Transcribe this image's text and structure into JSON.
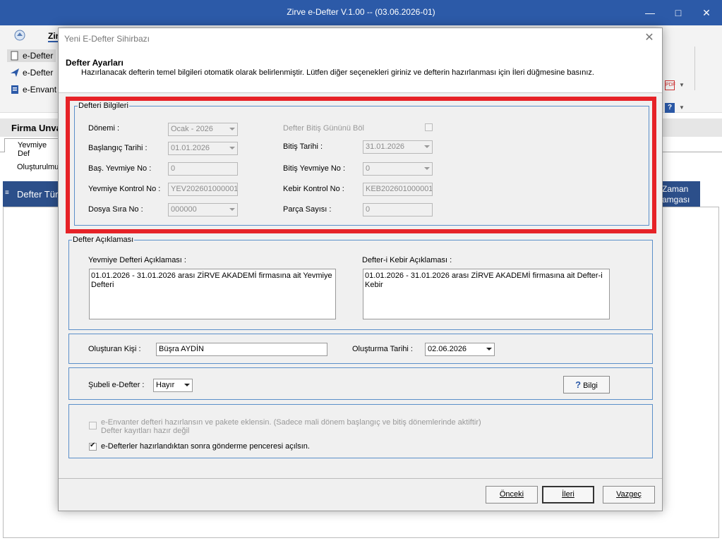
{
  "app": {
    "title": "Zirve e-Defter V.1.00  -- (03.06.2026-01)",
    "ribbon_tab": "Zir",
    "ribbon_items": [
      "e-Defter",
      "e-Defter",
      "e-Envant"
    ],
    "firma_label": "Firma Unva",
    "subtab": "Yevmiye Def",
    "olusturulmus": "Oluşturulmuş",
    "grid_col_left": "Defter Tür",
    "grid_col_right_line1": "Zaman",
    "grid_col_right_line2": "amgası"
  },
  "dialog": {
    "title": "Yeni E-Defter Sihirbazı",
    "header_title": "Defter Ayarları",
    "header_desc": "Hazırlanacak defterin temel bilgileri otomatik olarak belirlenmiştir. Lütfen diğer seçenekleri giriniz ve defterin hazırlanması için İleri düğmesine basınız.",
    "defteri_bilgileri": {
      "legend": "Defteri Bilgileri",
      "donemi_label": "Dönemi :",
      "donemi_value": "Ocak - 2026",
      "baslangic_label": "Başlangıç Tarihi :",
      "baslangic_value": "01.01.2026",
      "bas_yevmiye_label": "Baş. Yevmiye No :",
      "bas_yevmiye_value": "0",
      "yevmiye_kontrol_label": "Yevmiye Kontrol No :",
      "yevmiye_kontrol_value": "YEV202601000001",
      "dosya_sira_label": "Dosya Sıra No :",
      "dosya_sira_value": "000000",
      "bitis_gunu_label": "Defter Bitiş Gününü Böl",
      "bitis_label": "Bitiş Tarihi :",
      "bitis_value": "31.01.2026",
      "bitis_yevmiye_label": "Bitiş Yevmiye No :",
      "bitis_yevmiye_value": "0",
      "kebir_kontrol_label": "Kebir Kontrol No :",
      "kebir_kontrol_value": "KEB202601000001",
      "parca_label": "Parça Sayısı :",
      "parca_value": "0"
    },
    "defter_aciklamasi": {
      "legend": "Defter Açıklaması",
      "yevmiye_label": "Yevmiye Defteri Açıklaması :",
      "yevmiye_text": "01.01.2026 - 31.01.2026 arası ZİRVE AKADEMİ  firmasına ait Yevmiye Defteri",
      "kebir_label": "Defter-i Kebir Açıklaması :",
      "kebir_text": "01.01.2026 - 31.01.2026 arası ZİRVE AKADEMİ  firmasına ait Defter-i Kebir"
    },
    "olusturan": {
      "kisi_label": "Oluşturan Kişi :",
      "kisi_value": "Büşra AYDİN",
      "tarih_label": "Oluşturma Tarihi :",
      "tarih_value": "02.06.2026"
    },
    "subeli": {
      "label": "Şubeli e-Defter :",
      "value": "Hayır",
      "bilgi_label": "Bilgi"
    },
    "options": {
      "envanter_label": "e-Envanter defteri hazırlansın ve pakete eklensin. (Sadece mali dönem başlangıç ve bitiş dönemlerinde aktiftir)",
      "envanter_sub": "Defter kayıtları hazır değil",
      "gonderme_label": "e-Defterler hazırlandıktan sonra gönderme penceresi açılsın."
    },
    "buttons": {
      "onceki": "Önceki",
      "ileri": "İleri",
      "vazgec": "Vazgeç"
    }
  }
}
